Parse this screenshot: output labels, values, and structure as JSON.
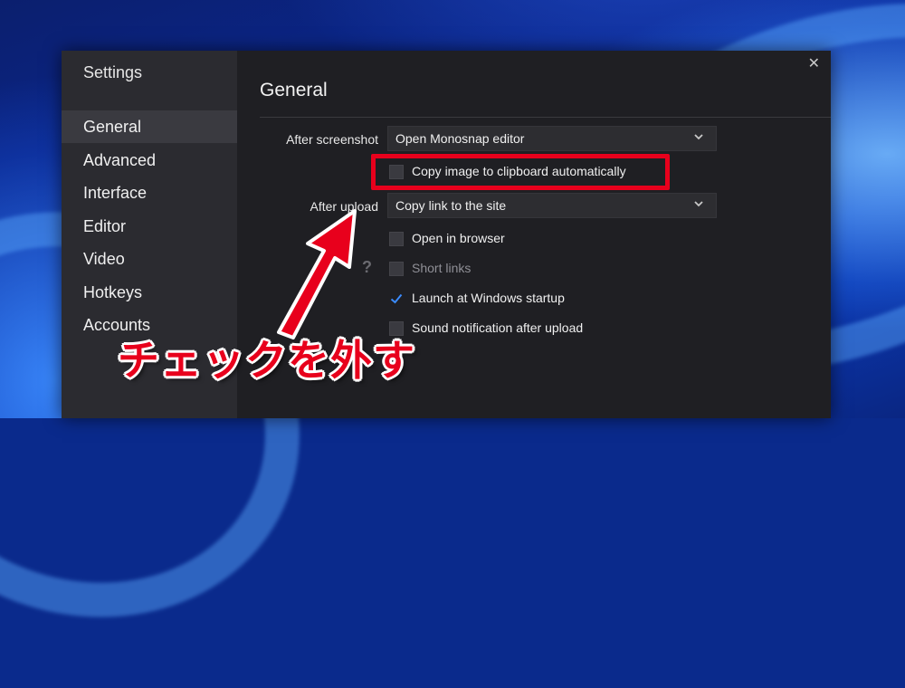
{
  "window": {
    "sidebar_title": "Settings",
    "close_glyph": "✕",
    "nav": [
      "General",
      "Advanced",
      "Interface",
      "Editor",
      "Video",
      "Hotkeys",
      "Accounts"
    ],
    "active_nav": "General"
  },
  "page": {
    "title": "General",
    "after_screenshot_label": "After screenshot",
    "after_screenshot_value": "Open Monosnap editor",
    "copy_clipboard_label": "Copy image to clipboard automatically",
    "after_upload_label": "After upload",
    "after_upload_value": "Copy link to the site",
    "open_browser_label": "Open in browser",
    "short_links_label": "Short links",
    "launch_startup_label": "Launch at Windows startup",
    "sound_notification_label": "Sound notification after upload",
    "help_glyph": "?",
    "checkbox_states": {
      "copy_clipboard": false,
      "open_browser": false,
      "short_links": false,
      "launch_startup": true,
      "sound_notification": false
    }
  },
  "annotation": {
    "text": "チェックを外す",
    "color": "#e8001c"
  },
  "icons": {
    "close": "close-icon",
    "chevron": "chevron-down-icon",
    "check": "checkmark-icon",
    "help": "question-icon",
    "arrow": "annotation-arrow-icon"
  },
  "colors": {
    "window_bg": "#1f1f23",
    "sidebar_bg": "#2b2b30",
    "accent_check": "#3b8cff",
    "highlight": "#e8001c"
  }
}
